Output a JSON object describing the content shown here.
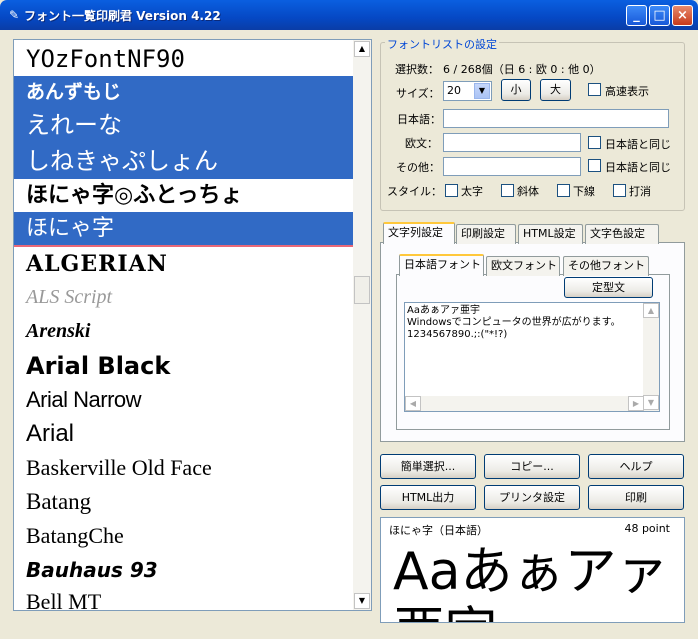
{
  "window": {
    "title": "フォント一覧印刷君  Version 4.22",
    "controls": {
      "minimize": "_",
      "maximize": "□",
      "close": "×"
    }
  },
  "font_list": {
    "items": [
      {
        "name": "YOzFontNF90",
        "state": "normal"
      },
      {
        "name": "あんずもじ",
        "state": "selected"
      },
      {
        "name": "えれーな",
        "state": "selected"
      },
      {
        "name": "しねきゃぷしょん",
        "state": "selected"
      },
      {
        "name": "ほにゃ字◎ふとっちょ",
        "state": "normal"
      },
      {
        "name": "ほにゃ字",
        "state": "focused"
      },
      {
        "name": "ALGERIAN",
        "state": "normal"
      },
      {
        "name": "ALS Script",
        "state": "normal"
      },
      {
        "name": "Arenski",
        "state": "normal"
      },
      {
        "name": "Arial Black",
        "state": "normal"
      },
      {
        "name": "Arial Narrow",
        "state": "normal"
      },
      {
        "name": "Arial",
        "state": "normal"
      },
      {
        "name": "Baskerville Old Face",
        "state": "normal"
      },
      {
        "name": "Batang",
        "state": "normal"
      },
      {
        "name": "BatangChe",
        "state": "normal"
      },
      {
        "name": "Bauhaus 93",
        "state": "normal"
      },
      {
        "name": "Bell MT",
        "state": "normal"
      }
    ],
    "scroll_up": "▲",
    "scroll_down": "▼"
  },
  "settings": {
    "group_label": "フォントリストの設定",
    "count_label": "選択数：",
    "count_value": "6 / 268個（日 6 : 欧 0 : 他 0）",
    "size_label": "サイズ：",
    "size_value": "20",
    "small_button": "小",
    "large_button": "大",
    "fast_display_label": "高速表示",
    "japanese_label": "日本語：",
    "western_label": "欧文：",
    "other_label": "その他：",
    "same_as_japanese_1": "日本語と同じ",
    "same_as_japanese_2": "日本語と同じ",
    "style_label": "スタイル：",
    "bold_label": "太字",
    "italic_label": "斜体",
    "underline_label": "下線",
    "strike_label": "打消"
  },
  "main_tabs": [
    "文字列設定",
    "印刷設定",
    "HTML設定",
    "文字色設定"
  ],
  "sub_tabs": [
    "日本語フォント",
    "欧文フォント",
    "その他フォント"
  ],
  "template_button": "定型文",
  "sample_text": [
    "Aaあぁアァ亜宇",
    "Windowsでコンピュータの世界が広がります。",
    "1234567890.;:(\"*!?)"
  ],
  "buttons": {
    "easy_select": "簡単選択...",
    "copy": "コピー...",
    "help": "ヘルプ",
    "html_output": "HTML出力",
    "printer_settings": "プリンタ設定",
    "print": "印刷"
  },
  "preview": {
    "font_label": "ほにゃ字（日本語）",
    "size_label": "48 point",
    "sample_line1": "Aaあぁアァ",
    "sample_line2": "亜宇"
  }
}
